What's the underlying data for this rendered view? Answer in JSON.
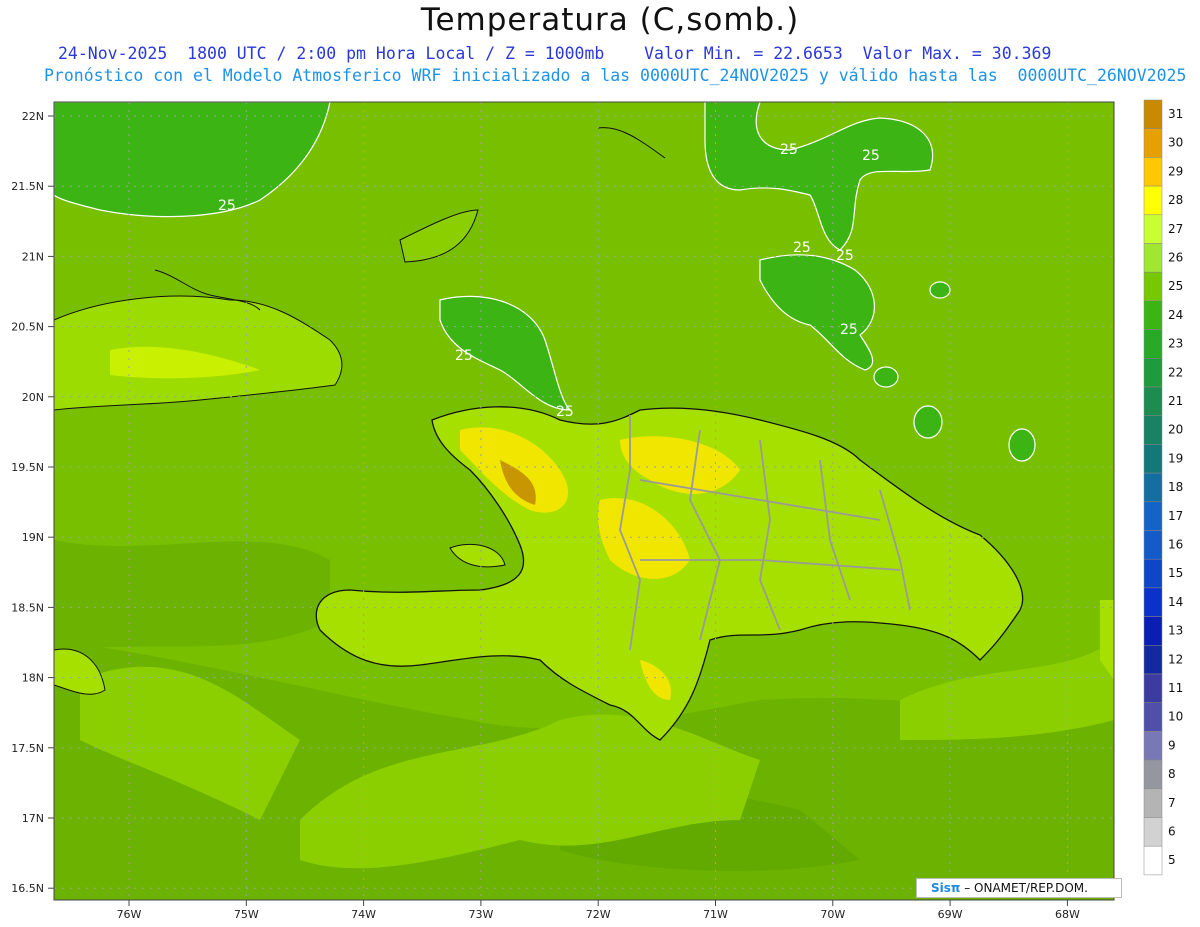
{
  "header": {
    "title": "Temperatura (C,somb.)",
    "subtitle_line1": "24-Nov-2025  1800 UTC / 2:00 pm Hora Local / Z = 1000mb    Valor Min. = 22.6653  Valor Max. = 30.369",
    "subtitle_line2": "Pronóstico con el Modelo Atmosferico WRF inicializado a las 0000UTC_24NOV2025 y válido hasta las  0000UTC_26NOV2025"
  },
  "axes": {
    "lat_labels": [
      "22N",
      "21.5N",
      "21N",
      "20.5N",
      "20N",
      "19.5N",
      "19N",
      "18.5N",
      "18N",
      "17.5N",
      "17N",
      "16.5N"
    ],
    "lon_labels": [
      "76W",
      "75W",
      "74W",
      "73W",
      "72W",
      "71W",
      "70W",
      "69W",
      "68W"
    ]
  },
  "contour_label": "25",
  "colorbar": {
    "levels": [
      "31",
      "30",
      "29",
      "28",
      "27",
      "26",
      "25",
      "24",
      "23",
      "22",
      "21",
      "20",
      "19",
      "18",
      "17",
      "16",
      "15",
      "14",
      "13",
      "12",
      "11",
      "10",
      "9",
      "8",
      "7",
      "6",
      "5"
    ],
    "colors": [
      "#c78a00",
      "#e6a100",
      "#ffc800",
      "#ffff00",
      "#c8ff32",
      "#a0e632",
      "#78c800",
      "#3cb414",
      "#28aa28",
      "#1e9b3c",
      "#1e8c50",
      "#198264",
      "#147878",
      "#146ea0",
      "#1464c8",
      "#145ac8",
      "#0f46c8",
      "#0a32c8",
      "#0a1eb4",
      "#1428a0",
      "#3c3ca0",
      "#5050aa",
      "#7878b4",
      "#9696a0",
      "#b4b4b4",
      "#d2d2d2",
      "#ffffff"
    ]
  },
  "credit": {
    "brand": "Sisπ",
    "org": "– ONAMET/REP.DOM."
  }
}
